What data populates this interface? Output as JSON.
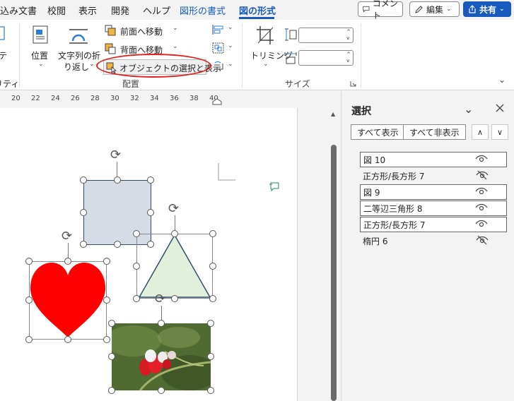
{
  "menubar": {
    "tabs": [
      {
        "label": "込み文書",
        "style": "normal"
      },
      {
        "label": "校閲",
        "style": "normal"
      },
      {
        "label": "表示",
        "style": "normal"
      },
      {
        "label": "開発",
        "style": "normal"
      },
      {
        "label": "ヘルプ",
        "style": "normal"
      },
      {
        "label": "図形の書式",
        "style": "contextual"
      },
      {
        "label": "図の形式",
        "style": "active"
      }
    ],
    "comment_label": "コメント",
    "edit_label": "編集",
    "share_label": "共有"
  },
  "ribbon": {
    "partial_left_top": "テ",
    "partial_left_bottom": "リティ",
    "position_label": "位置",
    "wrap_text_label_1": "文字列の折",
    "wrap_text_label_2": "り返し",
    "bring_forward_label": "前面へ移動",
    "send_backward_label": "背面へ移動",
    "selection_pane_label": "オブジェクトの選択と表示",
    "arrange_group_label": "配置",
    "crop_label": "トリミング",
    "size_group_label": "サイズ",
    "height_value": "",
    "width_value": ""
  },
  "ruler": {
    "ticks": [
      "20",
      "22",
      "24",
      "26",
      "28",
      "30",
      "32",
      "34",
      "36",
      "38",
      "40"
    ]
  },
  "selection_pane": {
    "title": "選択",
    "show_all_label": "すべて表示",
    "hide_all_label": "すべて非表示",
    "items": [
      {
        "name": "図 10",
        "visible": true,
        "boxed": true
      },
      {
        "name": "正方形/長方形 7",
        "visible": false,
        "boxed": false
      },
      {
        "name": "図 9",
        "visible": true,
        "boxed": true
      },
      {
        "name": "二等辺三角形 8",
        "visible": true,
        "boxed": true
      },
      {
        "name": "正方形/長方形 7",
        "visible": true,
        "boxed": true
      },
      {
        "name": "楕円 6",
        "visible": false,
        "boxed": false
      }
    ]
  },
  "colors": {
    "accent": "#185abd",
    "highlight_ring": "#e01f1f",
    "rectangle_fill": "#d6dce5",
    "triangle_fill": "#e2efda",
    "heart_fill": "#ff0000"
  }
}
